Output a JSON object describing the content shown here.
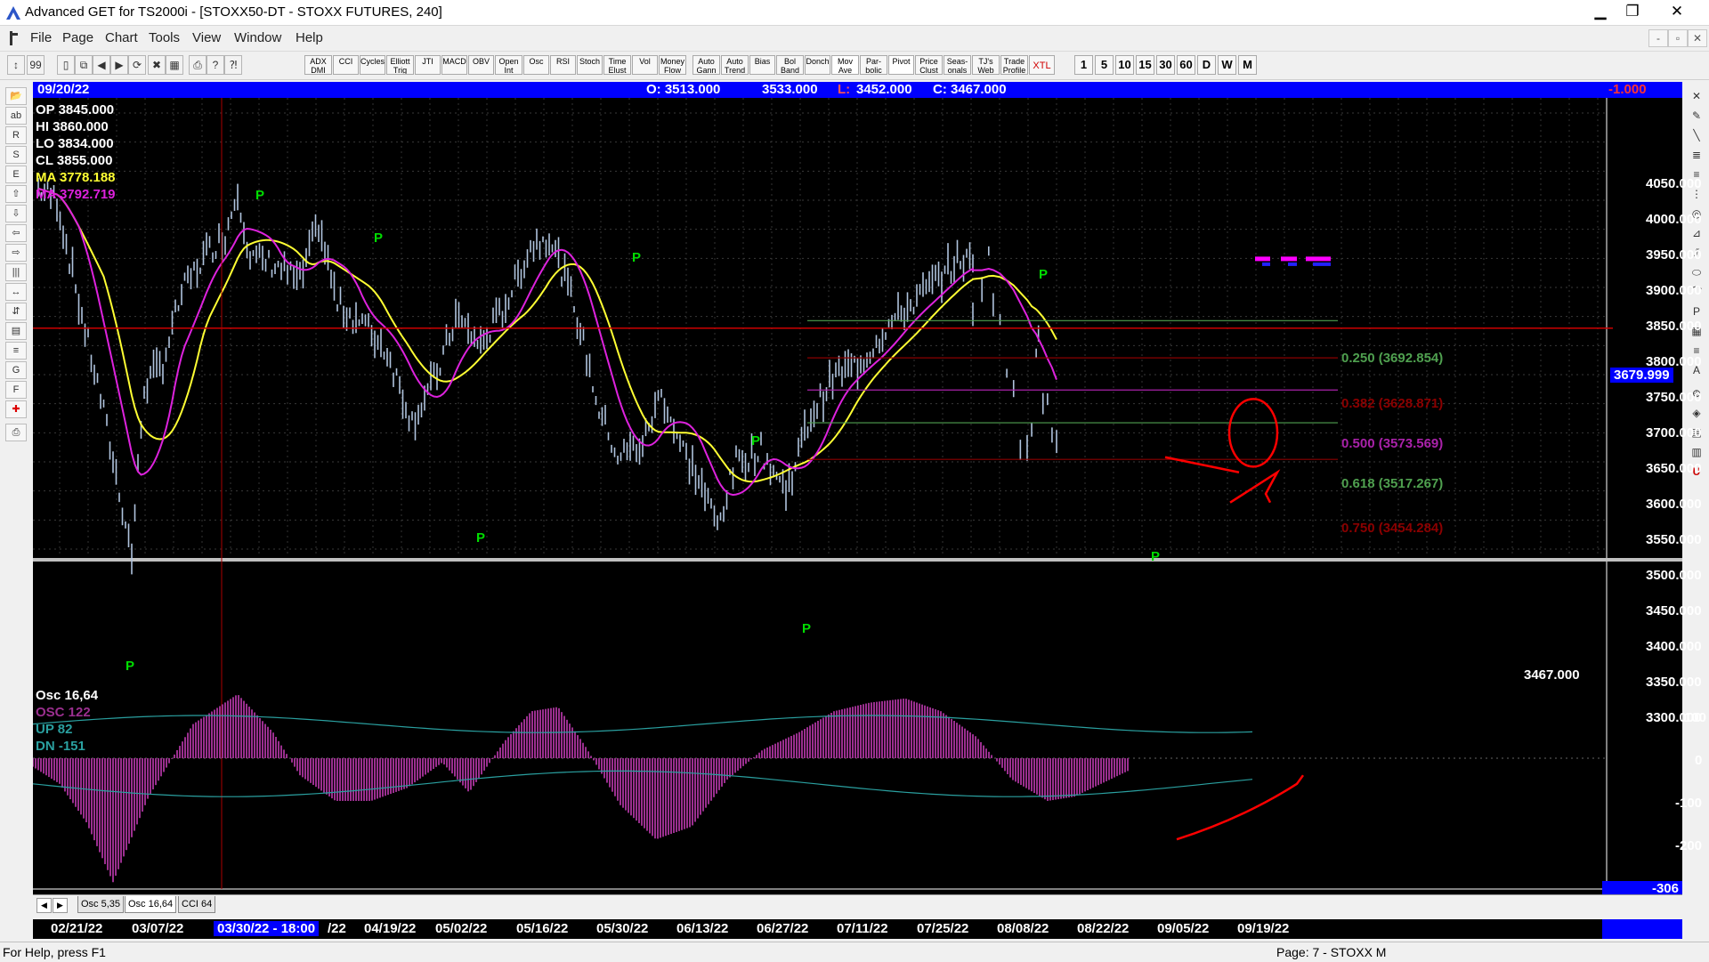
{
  "window": {
    "title": "Advanced GET for TS2000i - [STOXX50-DT - STOXX FUTURES, 240]",
    "buttons": {
      "minimize": "▁",
      "maximize": "❐",
      "close": "✕"
    }
  },
  "menu": {
    "items": [
      "File",
      "Page",
      "Chart",
      "Tools",
      "View",
      "Window",
      "Help"
    ],
    "mdi_buttons": [
      "-",
      "▫",
      "✕"
    ]
  },
  "toolbar": {
    "study_buttons": [
      "ADX DMI",
      "CCI",
      "Cycles",
      "Elliott Trig",
      "JTI",
      "MACD",
      "OBV",
      "Open Int",
      "Osc",
      "RSI",
      "Stoch",
      "Time Elust",
      "Vol",
      "Money Flow",
      "Auto Gann",
      "Auto Trend",
      "Bias",
      "Bol Band",
      "Donch",
      "Mov Ave",
      "Par- bolic",
      "Pivot",
      "Price Clust",
      "Seas- onals",
      "TJ's Web",
      "Trade Profile",
      "XTL"
    ],
    "intervals": [
      "1",
      "5",
      "10",
      "15",
      "30",
      "60",
      "D",
      "W",
      "M"
    ]
  },
  "header": {
    "date": "09/20/22",
    "ohlc_open": "O: 3513.000",
    "ohlc_high": "3533.000",
    "ohlc_low_label": "L:",
    "ohlc_low": "3452.000",
    "ohlc_close": "C: 3467.000",
    "change": "-1.000"
  },
  "info": {
    "op": "OP  3845.000",
    "hi": "HI   3860.000",
    "lo": "LO  3834.000",
    "cl": "CL  3855.000",
    "ma1": "MA  3778.188",
    "ma2": "MA  3792.719"
  },
  "price_axis": {
    "labels": [
      "4050.000",
      "4000.000",
      "3950.000",
      "3900.000",
      "3850.000",
      "3800.000",
      "3750.000",
      "3700.000",
      "3650.000",
      "3600.000",
      "3550.000",
      "3500.000",
      "3450.000",
      "3400.000",
      "3350.000",
      "3300.000"
    ],
    "current": "3679.999",
    "last": "3467.000"
  },
  "fib": {
    "f250": "0.250 (3692.854)",
    "f382": "0.382 (3628.871)",
    "f500": "0.500 (3573.569)",
    "f618": "0.618 (3517.267)",
    "f750": "0.750 (3454.284)"
  },
  "osc": {
    "title": "Osc 16,64",
    "osc": "OSC  122",
    "up": "UP    82",
    "dn": "DN   -151",
    "axis": [
      "100",
      "0",
      "-100",
      "-200"
    ],
    "current": "-306"
  },
  "pivot_marker": "P",
  "tabs": [
    "Osc 5,35",
    "Osc 16,64",
    "CCI 64"
  ],
  "date_axis": {
    "highlight": "03/30/22 - 18:00",
    "labels": [
      "02/21/22",
      "03/07/22",
      "/22",
      "04/19/22",
      "05/02/22",
      "05/16/22",
      "05/30/22",
      "06/13/22",
      "06/27/22",
      "07/11/22",
      "07/25/22",
      "08/08/22",
      "08/22/22",
      "09/05/22",
      "09/19/22"
    ]
  },
  "status": {
    "left": "For Help, press F1",
    "right": "Page: 7 - STOXX M"
  },
  "colors": {
    "background": "#000000",
    "price_bars": "#b0c4de",
    "ma_fast": "#ffff33",
    "ma_slow": "#dd22dd",
    "fib_250": "#4fa04f",
    "fib_382": "#8b0000",
    "fib_500": "#aa22aa",
    "fib_618": "#4fa04f",
    "fib_750": "#8b0000",
    "annotation": "#ff0000",
    "pivot": "#00dd00",
    "osc_fill": "#9b2f8f",
    "osc_bands": "#2aa0a0"
  }
}
